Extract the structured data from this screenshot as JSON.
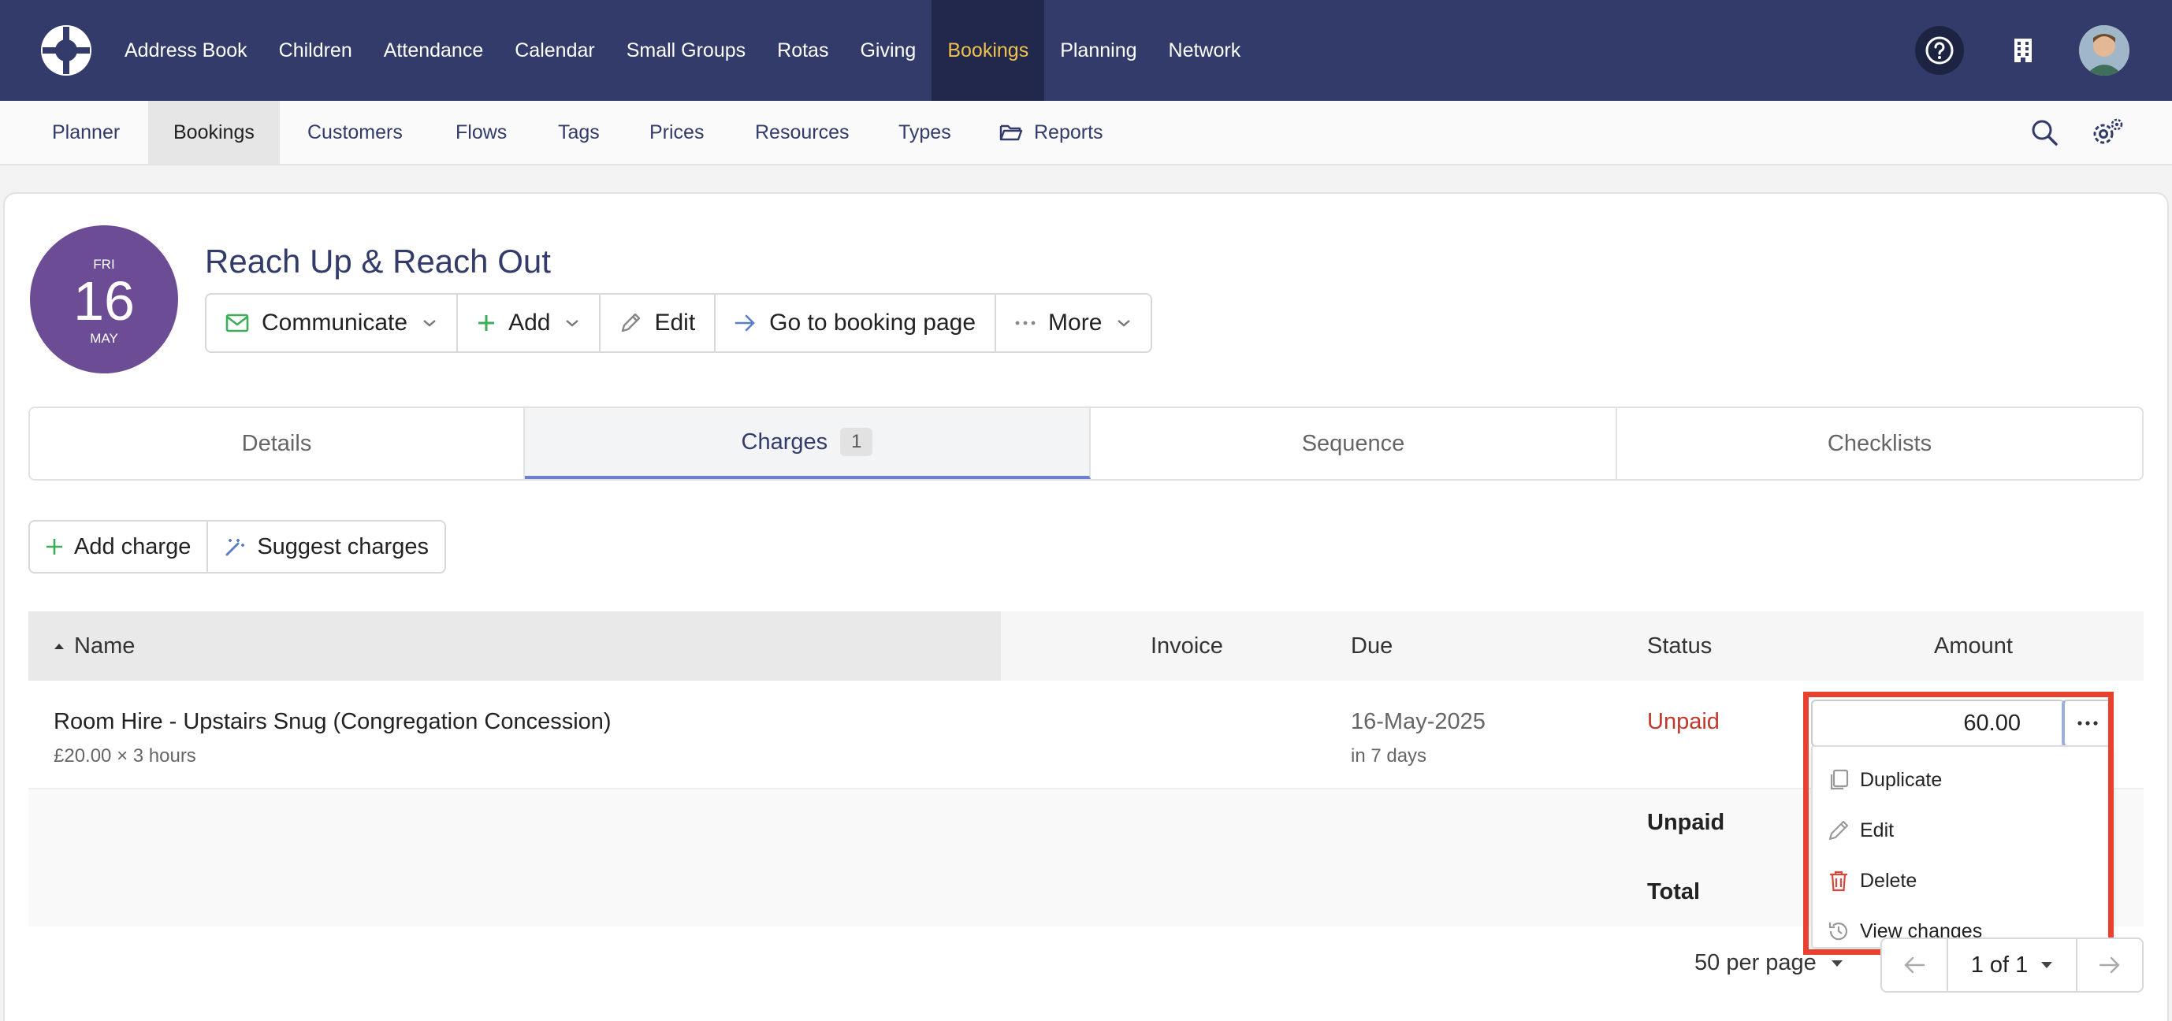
{
  "topnav": {
    "items": [
      {
        "label": "Address Book"
      },
      {
        "label": "Children"
      },
      {
        "label": "Attendance"
      },
      {
        "label": "Calendar"
      },
      {
        "label": "Small Groups"
      },
      {
        "label": "Rotas"
      },
      {
        "label": "Giving"
      },
      {
        "label": "Bookings",
        "active": true
      },
      {
        "label": "Planning"
      },
      {
        "label": "Network"
      }
    ],
    "accent_color": "#f2c14d",
    "background_color": "#323b6a"
  },
  "subnav": {
    "items": [
      {
        "label": "Planner"
      },
      {
        "label": "Bookings",
        "active": true
      },
      {
        "label": "Customers"
      },
      {
        "label": "Flows"
      },
      {
        "label": "Tags"
      },
      {
        "label": "Prices"
      },
      {
        "label": "Resources"
      },
      {
        "label": "Types"
      },
      {
        "label": "Reports",
        "icon": "folder-open-icon"
      }
    ]
  },
  "booking": {
    "date": {
      "dow": "FRI",
      "day": "16",
      "month": "MAY"
    },
    "title": "Reach Up & Reach Out",
    "actions": {
      "communicate": "Communicate",
      "add": "Add",
      "edit": "Edit",
      "go_to_booking_page": "Go to booking page",
      "more": "More"
    }
  },
  "tabs": [
    {
      "label": "Details"
    },
    {
      "label": "Charges",
      "count": "1",
      "active": true
    },
    {
      "label": "Sequence"
    },
    {
      "label": "Checklists"
    }
  ],
  "charge_actions": {
    "add_charge": "Add charge",
    "suggest_charges": "Suggest charges"
  },
  "table": {
    "headers": {
      "name": "Name",
      "invoice": "Invoice",
      "due": "Due",
      "status": "Status",
      "amount": "Amount"
    },
    "rows": [
      {
        "name": "Room Hire - Upstairs Snug (Congregation Concession)",
        "detail": "£20.00 × 3 hours",
        "due": "16-May-2025",
        "due_relative": "in 7 days",
        "status": "Unpaid",
        "amount": "60.00"
      }
    ],
    "summary": {
      "unpaid_label": "Unpaid",
      "total_label": "Total"
    },
    "status_color": "#c0392b"
  },
  "row_menu": {
    "items": [
      {
        "label": "Duplicate",
        "icon": "duplicate-icon"
      },
      {
        "label": "Edit",
        "icon": "pencil-icon"
      },
      {
        "label": "Delete",
        "icon": "trash-icon"
      },
      {
        "label": "View changes",
        "icon": "history-icon"
      }
    ]
  },
  "pagination": {
    "per_page": "50 per page",
    "page": "1 of 1"
  }
}
